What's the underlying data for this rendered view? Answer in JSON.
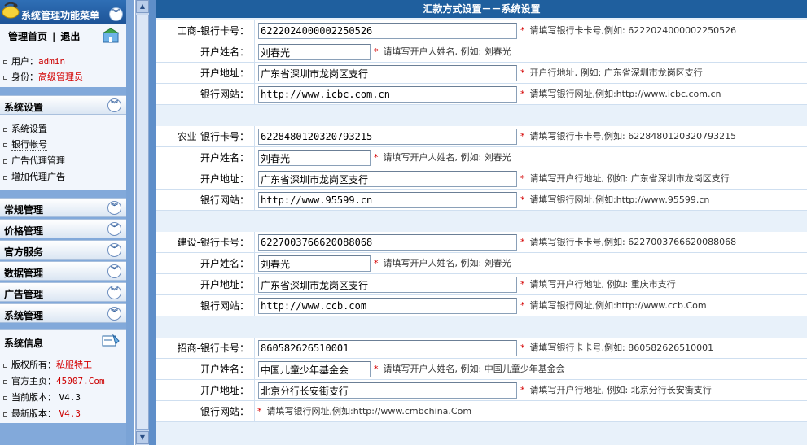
{
  "sidebar": {
    "menu_title": "系统管理功能菜单",
    "quick_links": {
      "home": "管理首页",
      "separator": "|",
      "logout": "退出"
    },
    "user_label": "用户：",
    "user_value": "admin",
    "role_label": "身份：",
    "role_value": "高级管理员",
    "sections": [
      {
        "label": "系统设置",
        "items": [
          "系统设置",
          "银行帐号",
          "广告代理管理",
          "增加代理广告"
        ]
      },
      {
        "label": "常规管理"
      },
      {
        "label": "价格管理"
      },
      {
        "label": "官方服务"
      },
      {
        "label": "数据管理"
      },
      {
        "label": "广告管理"
      },
      {
        "label": "系统管理"
      }
    ],
    "sysinfo": {
      "title": "系统信息",
      "rows": [
        {
          "label": "版权所有：",
          "value": "私服特工"
        },
        {
          "label": "官方主页：",
          "value": "45007.Com"
        },
        {
          "label": "当前版本：",
          "value": "V4.3"
        },
        {
          "label": "最新版本：",
          "value": "V4.3"
        }
      ]
    }
  },
  "main": {
    "title": "汇款方式设置－－系统设置",
    "banks": [
      {
        "card_label": "工商-银行卡号：",
        "card_value": "6222024000002250526",
        "card_hint": "请填写银行卡卡号,例如: 6222024000002250526",
        "name_label": "开户姓名：",
        "name_value": "刘春光",
        "name_hint": "请填写开户人姓名, 例如: 刘春光",
        "addr_label": "开户地址：",
        "addr_value": "广东省深圳市龙岗区支行",
        "addr_hint": "开户行地址, 例如: 广东省深圳市龙岗区支行",
        "site_label": "银行网站：",
        "site_value": "http://www.icbc.com.cn",
        "site_hint": "请填写银行网址,例如:http://www.icbc.com.cn"
      },
      {
        "card_label": "农业-银行卡号：",
        "card_value": "6228480120320793215",
        "card_hint": "请填写银行卡卡号,例如: 6228480120320793215",
        "name_label": "开户姓名：",
        "name_value": "刘春光",
        "name_hint": "请填写开户人姓名, 例如: 刘春光",
        "addr_label": "开户地址：",
        "addr_value": "广东省深圳市龙岗区支行",
        "addr_hint": "请填写开户行地址, 例如: 广东省深圳市龙岗区支行",
        "site_label": "银行网站：",
        "site_value": "http://www.95599.cn",
        "site_hint": "请填写银行网址,例如:http://www.95599.cn"
      },
      {
        "card_label": "建设-银行卡号：",
        "card_value": "6227003766620088068",
        "card_hint": "请填写银行卡卡号,例如: 6227003766620088068",
        "name_label": "开户姓名：",
        "name_value": "刘春光",
        "name_hint": "请填写开户人姓名, 例如: 刘春光",
        "addr_label": "开户地址：",
        "addr_value": "广东省深圳市龙岗区支行",
        "addr_hint": "请填写开户行地址, 例如: 重庆市支行",
        "site_label": "银行网站：",
        "site_value": "http://www.ccb.com",
        "site_hint": "请填写银行网址,例如:http://www.ccb.Com"
      },
      {
        "card_label": "招商-银行卡号：",
        "card_value": "860582626510001",
        "card_hint": "请填写银行卡卡号,例如: 860582626510001",
        "name_label": "开户姓名：",
        "name_value": "中国儿童少年基金会",
        "name_hint": "请填写开户人姓名, 例如: 中国儿童少年基金会",
        "addr_label": "开户地址：",
        "addr_value": "北京分行长安街支行",
        "addr_hint": "请填写开户行地址, 例如: 北京分行长安街支行",
        "site_label": "银行网站：",
        "site_value": "",
        "site_hint": "请填写银行网址,例如:http://www.cmbchina.Com"
      }
    ],
    "star": "*"
  }
}
